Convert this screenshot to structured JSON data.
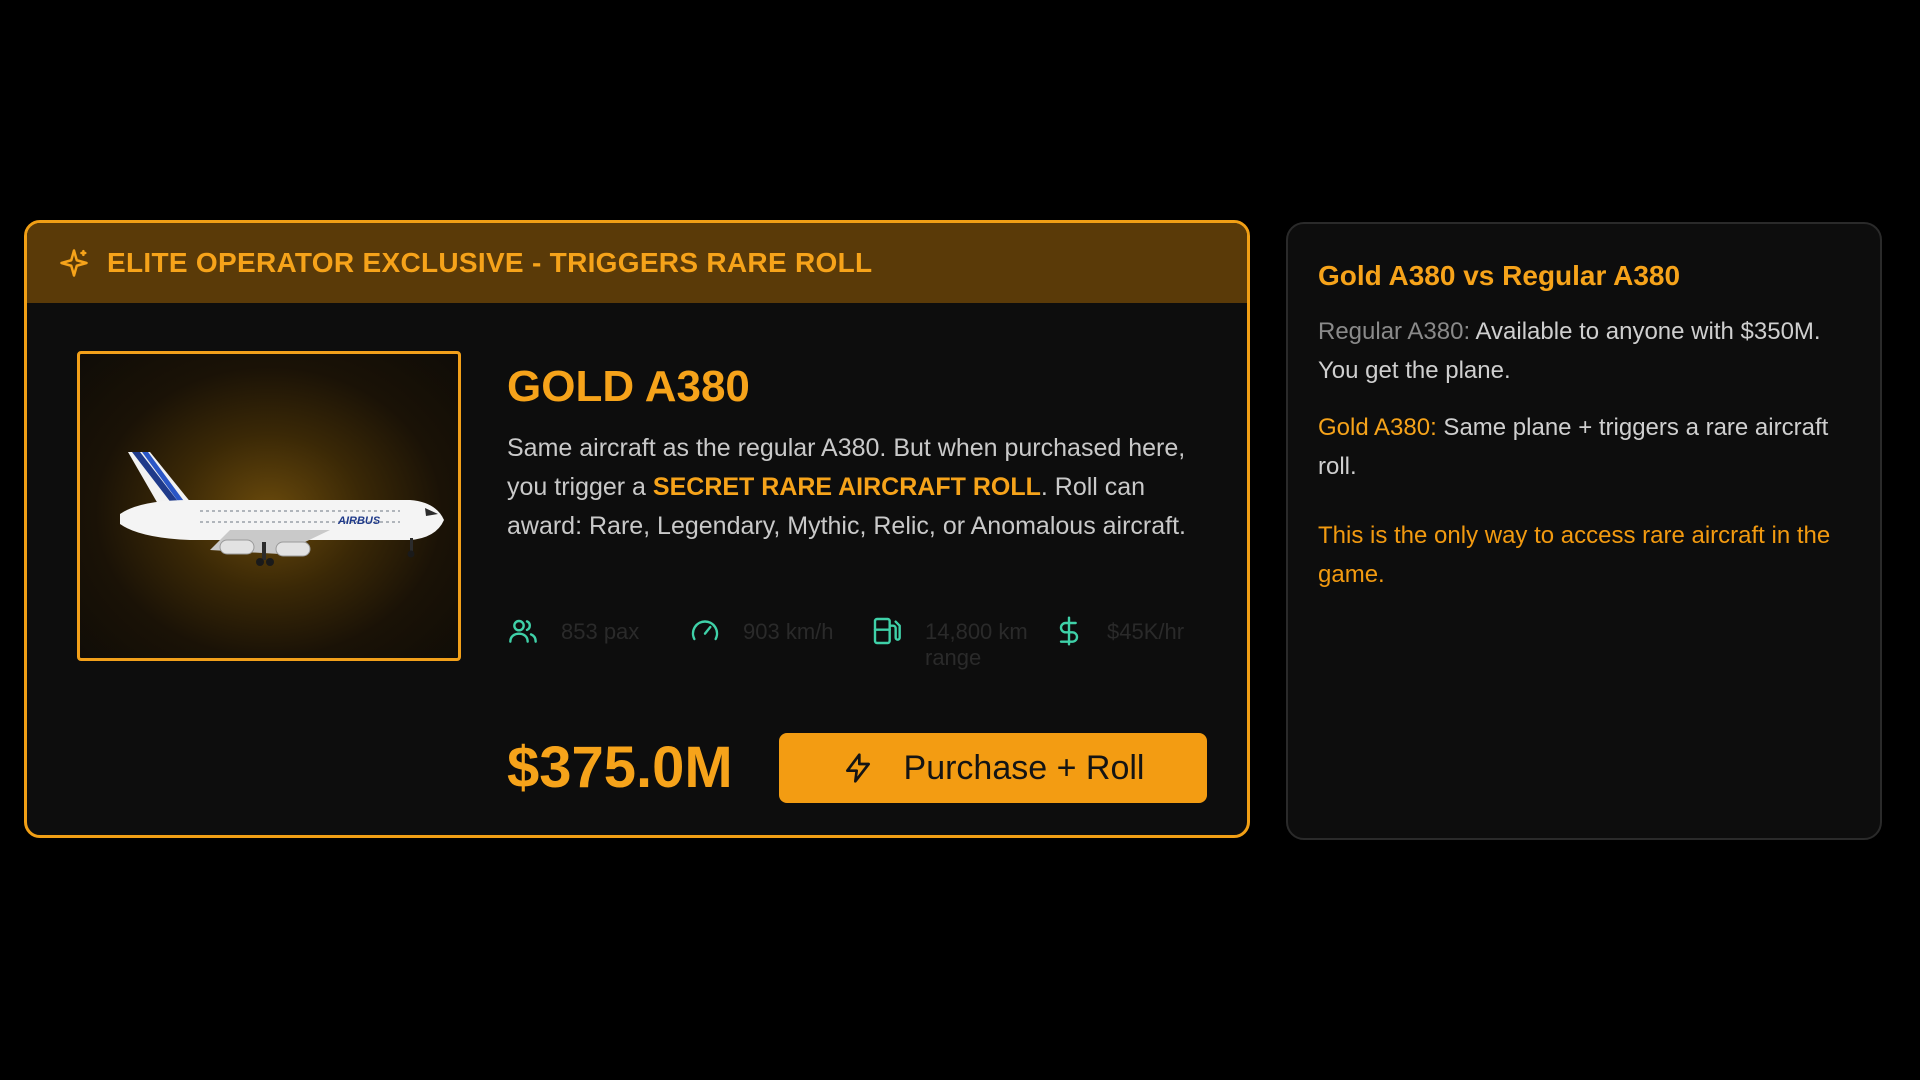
{
  "colors": {
    "accent": "#f6a31a",
    "banner_bg": "#5a3a08",
    "card_bg": "#0d0d0d",
    "button_bg": "#f39c12",
    "stat_icon": "#3fd1a8"
  },
  "product": {
    "banner_icon": "sparkle-icon",
    "banner_text": "ELITE OPERATOR EXCLUSIVE - TRIGGERS RARE ROLL",
    "title": "GOLD A380",
    "description_before": "Same aircraft as the regular A380. But when purchased here, you trigger a ",
    "description_highlight": "SECRET RARE AIRCRAFT ROLL",
    "description_after": ". Roll can award: Rare, Legendary, Mythic, Relic, or Anomalous aircraft.",
    "image_alt": "Airbus A380 aircraft",
    "stats": [
      {
        "icon": "users-icon",
        "value": "853 pax"
      },
      {
        "icon": "speedometer-icon",
        "value": "903 km/h"
      },
      {
        "icon": "fuel-icon",
        "value": "14,800 km range"
      },
      {
        "icon": "dollar-icon",
        "value": "$45K/hr"
      }
    ],
    "price": "$375.0M",
    "button_icon": "lightning-icon",
    "button_label": "Purchase + Roll"
  },
  "comparison": {
    "title": "Gold A380 vs Regular A380",
    "regular_label": "Regular A380:",
    "regular_text": " Available to anyone with $350M. You get the plane.",
    "gold_label": "Gold A380:",
    "gold_text": " Same plane + triggers a rare aircraft roll.",
    "note": "This is the only way to access rare aircraft in the game."
  }
}
